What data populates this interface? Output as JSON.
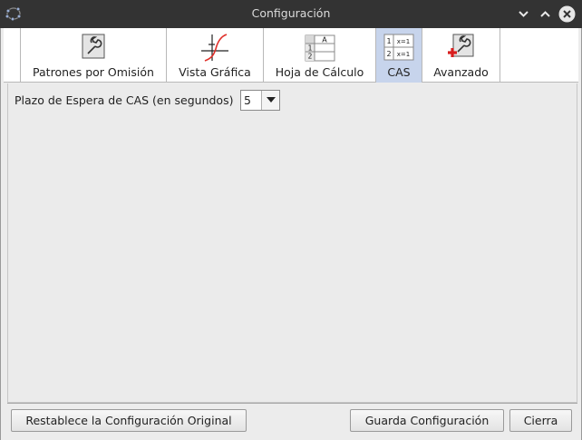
{
  "window": {
    "title": "Configuración",
    "controls": [
      "minimize",
      "maximize",
      "close"
    ]
  },
  "tabs": [
    {
      "label": "Patrones por Omisión",
      "icon": "wrench-icon",
      "active": false
    },
    {
      "label": "Vista Gráfica",
      "icon": "graph-view-icon",
      "active": false
    },
    {
      "label": "Hoja de Cálculo",
      "icon": "spreadsheet-icon",
      "active": false
    },
    {
      "label": "CAS",
      "icon": "cas-icon",
      "active": true
    },
    {
      "label": "Avanzado",
      "icon": "advanced-wrench-plus-icon",
      "active": false
    }
  ],
  "cas_panel": {
    "timeout_label": "Plazo de Espera de CAS (en segundos)",
    "timeout_value": "5"
  },
  "footer": {
    "reset_label": "Restablece la Configuración Original",
    "save_label": "Guarda Configuración",
    "close_label": "Cierra"
  },
  "icon_text": {
    "spreadsheet_col": "A",
    "spreadsheet_row1": "1",
    "spreadsheet_row2": "2",
    "cas_row1_num": "1",
    "cas_row1_expr": "x=1",
    "cas_row2_num": "2",
    "cas_row2_expr": "x=1"
  },
  "colors": {
    "titlebar": "#333333",
    "active_tab": "#c7d4ec",
    "panel_bg": "#ebebeb",
    "plus_red": "#d81e1e"
  }
}
